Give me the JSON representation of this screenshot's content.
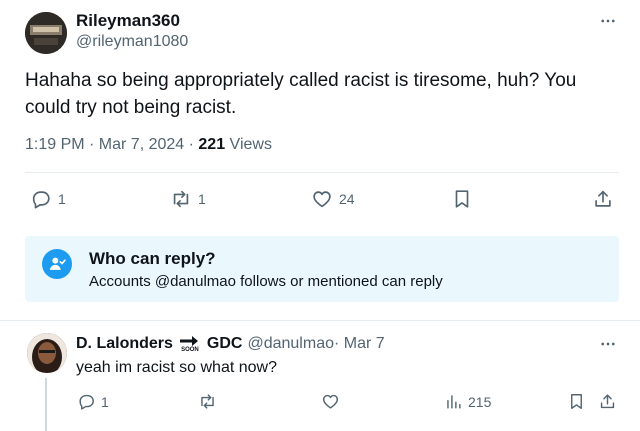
{
  "tweet": {
    "author_name": "Rileyman360",
    "author_handle": "@rileyman1080",
    "text": "Hahaha so being appropriately called racist is tiresome, huh? You could try not being racist.",
    "time": "1:19 PM · Mar 7, 2024 · ",
    "views_count": "221",
    "views_label": " Views",
    "replies": "1",
    "reposts": "1",
    "likes": "24"
  },
  "who_can_reply": {
    "title": "Who can reply?",
    "subtitle": "Accounts @danulmao follows or mentioned can reply"
  },
  "reply": {
    "author_name": "D. Lalonders",
    "soon_badge": "SOON",
    "author_suffix": "GDC",
    "author_handle": "@danulmao",
    "date": " · Mar 7",
    "text": "yeah im racist so what now?",
    "replies": "1",
    "views": "215"
  },
  "icons": [
    "more-icon",
    "reply-icon",
    "repost-icon",
    "like-icon",
    "bookmark-icon",
    "share-icon",
    "views-icon",
    "person-check-icon",
    "arrow-icon"
  ],
  "colors": {
    "accent": "#1d9bf0",
    "muted": "#536471",
    "text": "#0f1419",
    "reply_box_bg": "#eaf7fd"
  }
}
